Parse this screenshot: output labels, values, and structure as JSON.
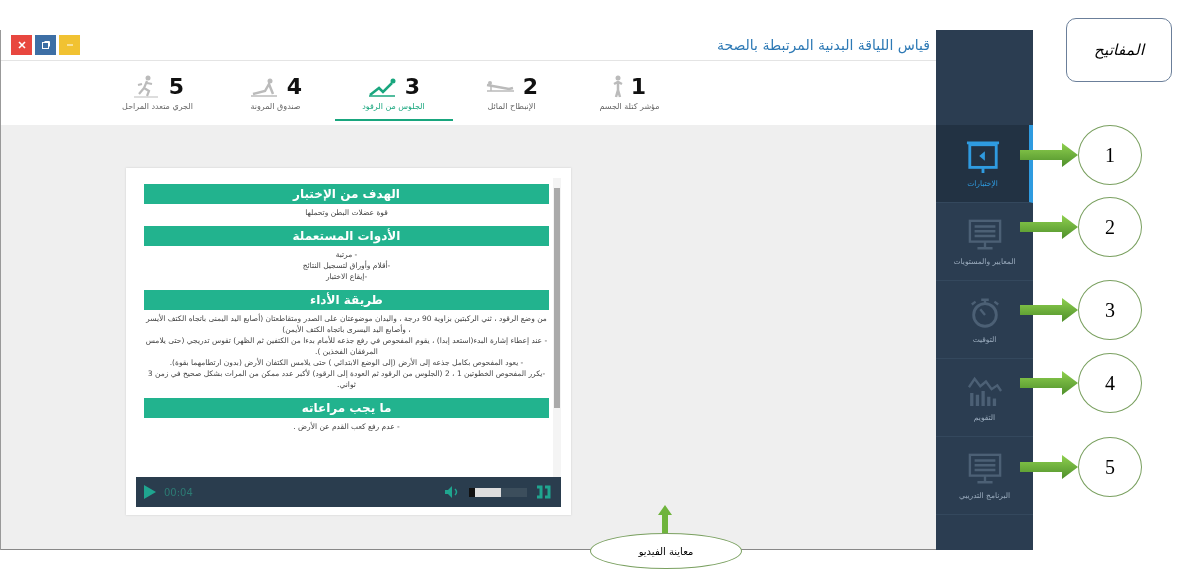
{
  "window": {
    "title": "قياس اللياقة البدنية المرتبطة بالصحة",
    "controls": [
      {
        "kind": "close"
      },
      {
        "kind": "restore"
      },
      {
        "kind": "minimize"
      }
    ]
  },
  "tabs": [
    {
      "number": "1",
      "label": "مؤشر كتلة الجسم",
      "kind": "standing",
      "selected": false
    },
    {
      "number": "2",
      "label": "الإنبطاح المائل",
      "kind": "pushup",
      "selected": false
    },
    {
      "number": "3",
      "label": "الجلوس من الرقود",
      "kind": "situp",
      "selected": true
    },
    {
      "number": "4",
      "label": "صندوق المرونة",
      "kind": "stretch",
      "selected": false
    },
    {
      "number": "5",
      "label": "الجري متعدد المراحل",
      "kind": "running",
      "selected": false
    }
  ],
  "sections": [
    {
      "heading": "الهدف من الإختبار",
      "lines": [
        "قوة عضلات البطن وتحملها"
      ]
    },
    {
      "heading": "الأدوات المستعملة",
      "lines": [
        "- مرتبة",
        "-أقلام وأوراق لتسجيل النتائج",
        "-إيقاع الاختبار"
      ]
    },
    {
      "heading": "طريقة الأداء",
      "lines": [
        "من وضع الرقود ، ثني الركبتين بزاوية 90 درجة ، واليدان موضوعتان على الصدر ومتقاطعتان (أصابع اليد اليمنى باتجاه الكتف الأيسر ، وأصابع اليد اليسرى باتجاه الكتف الأيمن)",
        "- عند إعطاء إشارة البدء(استعد إبدا) ، يقوم المفحوص في رفع جذعه للأمام بدءا من الكتفين ثم الظهر) تقوس تدريجي (حتى يلامس المرفقان الفخذين ).",
        "- يعود المفحوص بكامل جذعه إلى الأرض (إلى الوضع الابتدائي ) حتى يلامس الكتفان الأرض (بدون ارتطامهما بقوة).",
        "-يكرر المفحوص الخطوتين 1 ، 2 (الجلوس من الرقود ثم العودة إلى الرقود) لأكبر عدد ممكن من المرات بشكل صحيح في زمن 3 ثواني."
      ]
    },
    {
      "heading": "ما يجب مراعاته",
      "lines": [
        "- عدم رفع كعب القدم عن الأرض ."
      ]
    }
  ],
  "player": {
    "time": "00:04",
    "volume": {
      "level": 0.55
    }
  },
  "sidebar": {
    "items": [
      {
        "label": "الإختبارات",
        "kind": "presentation",
        "selected": true
      },
      {
        "label": "المعايير والمستويات",
        "kind": "monitor",
        "selected": false
      },
      {
        "label": "التوقيت",
        "kind": "stopwatch",
        "selected": false
      },
      {
        "label": "التقويم",
        "kind": "chart",
        "selected": false
      },
      {
        "label": "البرنامج التدريبي",
        "kind": "monitor",
        "selected": false
      }
    ]
  },
  "annotations": {
    "legend": "المفاتيح",
    "markers": [
      "1",
      "2",
      "3",
      "4",
      "5"
    ],
    "video_callout": "معاينة الفيديو"
  }
}
